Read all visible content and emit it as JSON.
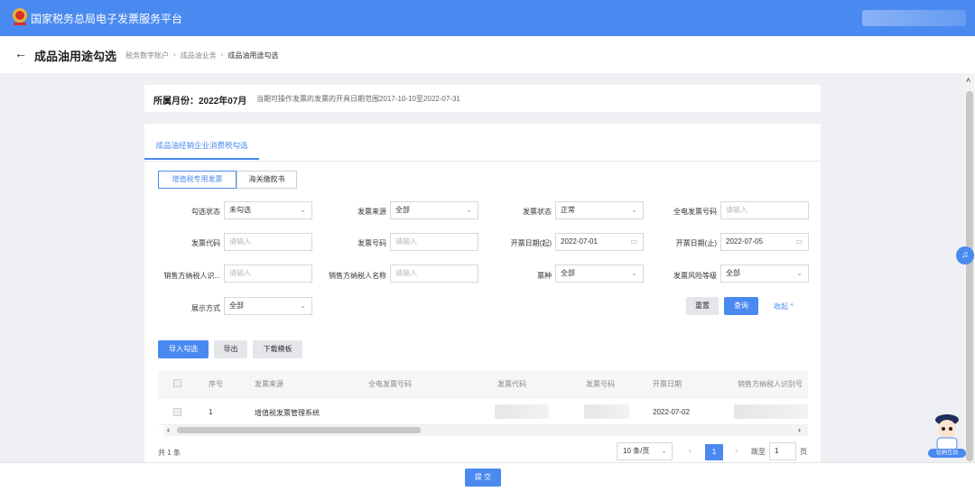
{
  "header": {
    "site_title": "国家税务总局电子发票服务平台"
  },
  "page": {
    "title": "成品油用途勾选",
    "breadcrumb": [
      "税务数字账户",
      "成品油业务",
      "成品油用途勾选"
    ],
    "back_icon": "arrow-left-icon"
  },
  "period": {
    "label": "所属月份：2022年07月",
    "note": "当期可操作发票的发票的开具日期范围2017-10-10至2022-07-31"
  },
  "tabs": {
    "main": "成品油经销企业消费税勾选"
  },
  "subtabs": {
    "vat": "增值税专用发票",
    "customs": "海关缴款书"
  },
  "filters": {
    "check_status": {
      "label": "勾选状态",
      "value": "未勾选"
    },
    "source": {
      "label": "发票来源",
      "value": "全部"
    },
    "invoice_status": {
      "label": "发票状态",
      "value": "正常"
    },
    "full_number": {
      "label": "全电发票号码",
      "placeholder": "请输入"
    },
    "invoice_code": {
      "label": "发票代码",
      "placeholder": "请输入"
    },
    "invoice_number": {
      "label": "发票号码",
      "placeholder": "请输入"
    },
    "date_start": {
      "label": "开票日期(起)",
      "value": "2022-07-01"
    },
    "date_end": {
      "label": "开票日期(止)",
      "value": "2022-07-05"
    },
    "seller_tax_id": {
      "label": "销售方纳税人识...",
      "placeholder": "请输入"
    },
    "seller_name": {
      "label": "销售方纳税人名称",
      "placeholder": "请输入"
    },
    "ticket_type": {
      "label": "票种",
      "value": "全部"
    },
    "risk_level": {
      "label": "发票风险等级",
      "value": "全部"
    },
    "display_mode": {
      "label": "展示方式",
      "value": "全部"
    }
  },
  "actions": {
    "reset": "重置",
    "query": "查询",
    "collapse": "收起 ^",
    "import_check": "导入勾选",
    "export": "导出",
    "download_template": "下载模板"
  },
  "table": {
    "columns": [
      "序号",
      "发票来源",
      "全电发票号码",
      "发票代码",
      "发票号码",
      "开票日期",
      "销售方纳税人识别号"
    ],
    "rows": [
      {
        "index": "1",
        "source": "增值税发票管理系统",
        "full_number": "",
        "code": "",
        "number": "",
        "date": "2022-07-02",
        "seller_id": ""
      }
    ]
  },
  "pagination": {
    "total": "共 1 条",
    "page_size": "10 条/页",
    "current": "1",
    "goto_label": "跳至",
    "goto_value": "1",
    "goto_unit": "页"
  },
  "footer": {
    "submit": "提 交"
  },
  "assistant": {
    "label": "征纳互动"
  },
  "colors": {
    "primary": "#4a8af0"
  }
}
